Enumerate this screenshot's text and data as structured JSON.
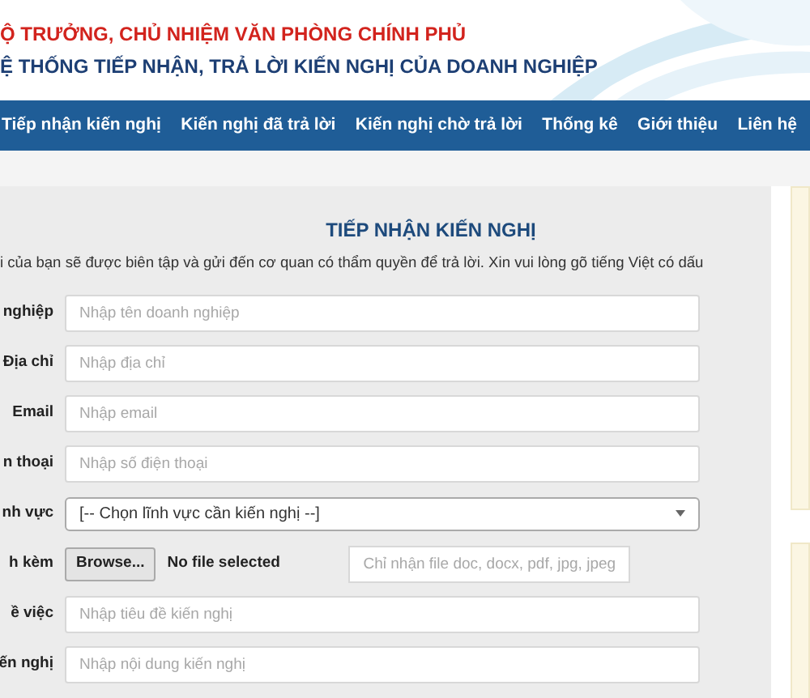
{
  "header": {
    "line_1": "Ộ TRƯỞNG, CHỦ NHIỆM VĂN PHÒNG CHÍNH PHỦ",
    "line_2": "Ệ THỐNG TIẾP NHẬN, TRẢ LỜI KIẾN NGHỊ CỦA DOANH NGHIỆP"
  },
  "nav": [
    {
      "label": "Tiếp nhận kiến nghị"
    },
    {
      "label": "Kiến nghị đã trả lời"
    },
    {
      "label": "Kiến nghị chờ trả lời"
    },
    {
      "label": "Thống kê"
    },
    {
      "label": "Giới thiệu"
    },
    {
      "label": "Liên hệ"
    }
  ],
  "form": {
    "title": "TIẾP NHẬN KIẾN NGHỊ",
    "intro": "i của bạn sẽ được biên tập và gửi đến cơ quan có thẩm quyền để trả lời. Xin vui lòng gõ tiếng Việt có dấu",
    "fields": [
      {
        "kind": "text",
        "label": "nghiệp",
        "placeholder": "Nhập tên doanh nghiệp"
      },
      {
        "kind": "text",
        "label": "Địa chỉ",
        "placeholder": "Nhập địa chỉ"
      },
      {
        "kind": "text",
        "label": "Email",
        "placeholder": "Nhập email"
      },
      {
        "kind": "text",
        "label": "n thoại",
        "placeholder": "Nhập số điện thoại"
      },
      {
        "kind": "select",
        "label": "nh vực",
        "value": "[-- Chọn lĩnh vực cần kiến nghị --]"
      },
      {
        "kind": "file",
        "label": "h kèm",
        "button": "Browse...",
        "status": "No file selected",
        "placeholder": "Chỉ nhận file doc, docx, pdf, jpg, jpeg"
      },
      {
        "kind": "text",
        "label": "ề việc",
        "placeholder": "Nhập tiêu đề kiến nghị"
      },
      {
        "kind": "text",
        "label": "ến nghị",
        "placeholder": "Nhập nội dung kiến nghị"
      }
    ]
  }
}
